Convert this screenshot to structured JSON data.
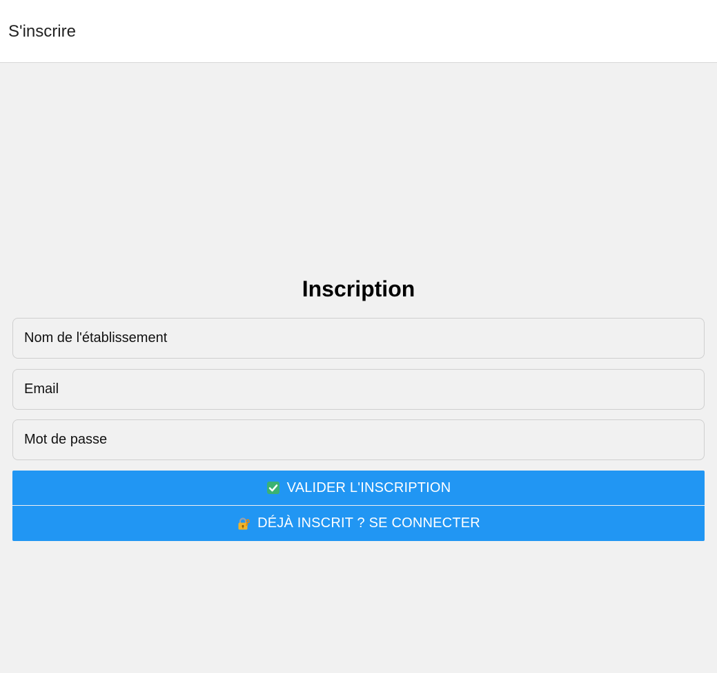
{
  "header": {
    "title": "S'inscrire"
  },
  "form": {
    "title": "Inscription",
    "fields": {
      "establishment_name": {
        "placeholder": "Nom de l'établissement",
        "value": ""
      },
      "email": {
        "placeholder": "Email",
        "value": ""
      },
      "password": {
        "placeholder": "Mot de passe",
        "value": ""
      }
    },
    "buttons": {
      "submit": {
        "label": "VALIDER L'INSCRIPTION",
        "icon": "check-mark-icon"
      },
      "login": {
        "label": "DÉJÀ INSCRIT ? SE CONNECTER",
        "icon": "lock-with-key-icon"
      }
    }
  },
  "colors": {
    "page_background": "#f1f1f1",
    "header_background": "#ffffff",
    "button_background": "#2196f3",
    "button_text": "#ffffff"
  }
}
